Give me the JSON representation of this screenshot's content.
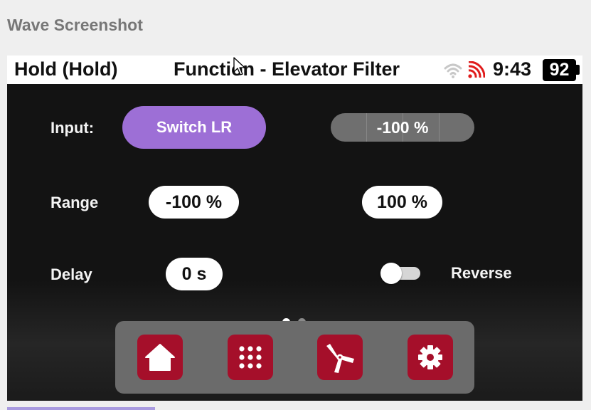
{
  "window": {
    "title": "Wave Screenshot"
  },
  "status_bar": {
    "mode": "Hold (Hold)",
    "function_title": "Function - Elevator Filter",
    "time": "9:43",
    "battery": "92",
    "icons": {
      "wifi": "wifi-icon",
      "signal": "signal-icon"
    },
    "signal_color": "#e01b1b"
  },
  "input": {
    "label": "Input:",
    "source": "Switch LR",
    "source_color": "#9d6fd6",
    "value": "-100 %"
  },
  "range": {
    "label": "Range",
    "min": "-100 %",
    "max": "100 %"
  },
  "delay": {
    "label": "Delay",
    "value": "0 s"
  },
  "reverse": {
    "label": "Reverse",
    "enabled": false
  },
  "pager": {
    "pages": 2,
    "current": 1
  },
  "dock": {
    "accent": "#a50f2a",
    "items": [
      {
        "icon": "home-icon"
      },
      {
        "icon": "apps-grid-icon"
      },
      {
        "icon": "propeller-icon"
      },
      {
        "icon": "gear-icon"
      }
    ]
  }
}
